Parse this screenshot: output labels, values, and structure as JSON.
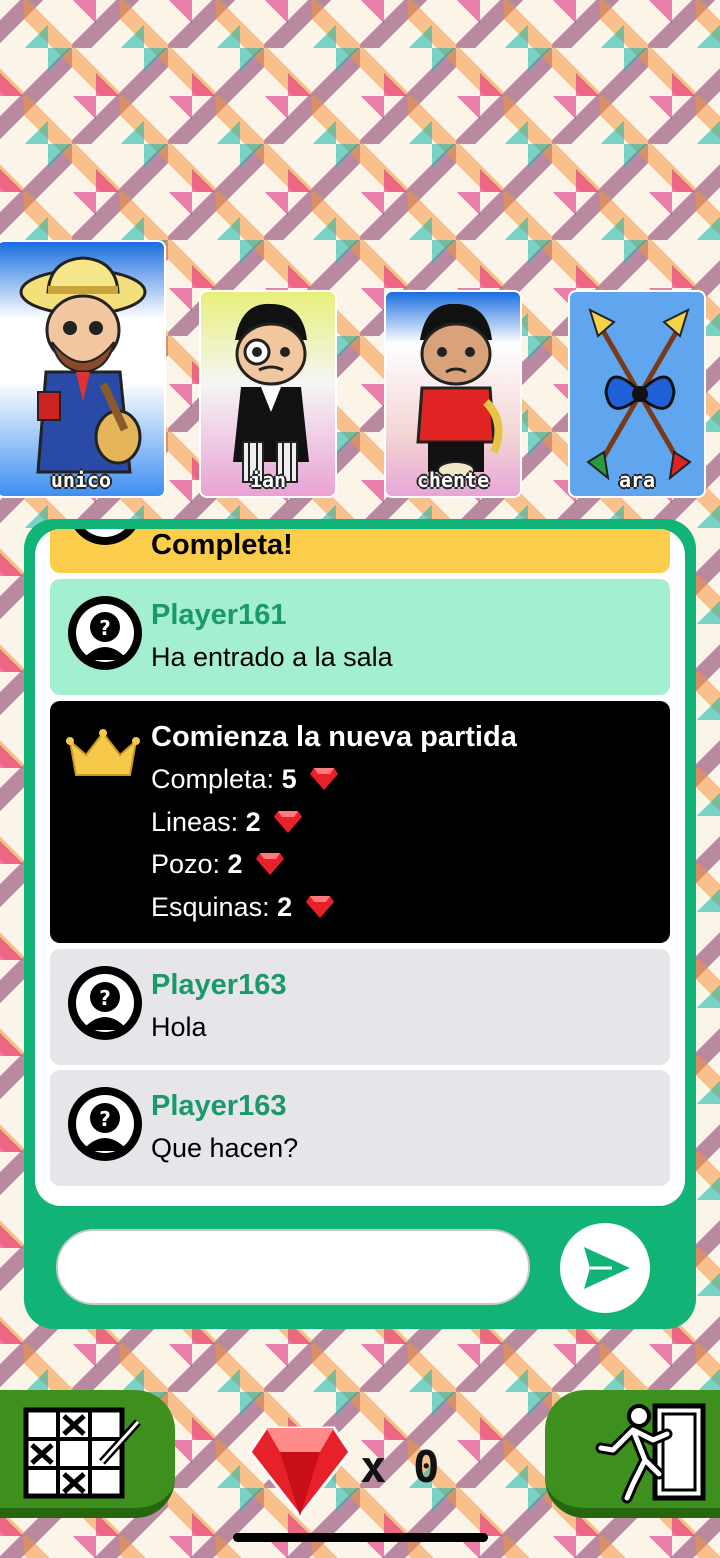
{
  "cards": [
    {
      "label": "unico"
    },
    {
      "label": "ian"
    },
    {
      "label": "chente"
    },
    {
      "label": "ara"
    }
  ],
  "chat": {
    "messages": [
      {
        "type": "winner",
        "title": "Completa!"
      },
      {
        "type": "user",
        "name": "Player161",
        "text": "Ha entrado a la sala"
      },
      {
        "type": "game",
        "title": "Comienza la nueva partida",
        "prizes": [
          {
            "label": "Completa: ",
            "value": "5"
          },
          {
            "label": "Lineas: ",
            "value": "2"
          },
          {
            "label": "Pozo: ",
            "value": "2"
          },
          {
            "label": "Esquinas: ",
            "value": "2"
          }
        ]
      },
      {
        "type": "user",
        "name": "Player163",
        "text": "Hola"
      },
      {
        "type": "user",
        "name": "Player163",
        "text": "Que hacen?"
      }
    ],
    "input_value": ""
  },
  "footer": {
    "gem_count": "x 0"
  },
  "colors": {
    "panel_green": "#12b377",
    "name_green": "#1a9a6a",
    "winner_yellow": "#fbcd4b",
    "joined_green": "#a5efd1",
    "chat_gray": "#e5e5ea",
    "button_green": "#3d8f1e",
    "gem_red": "#e8202a"
  }
}
